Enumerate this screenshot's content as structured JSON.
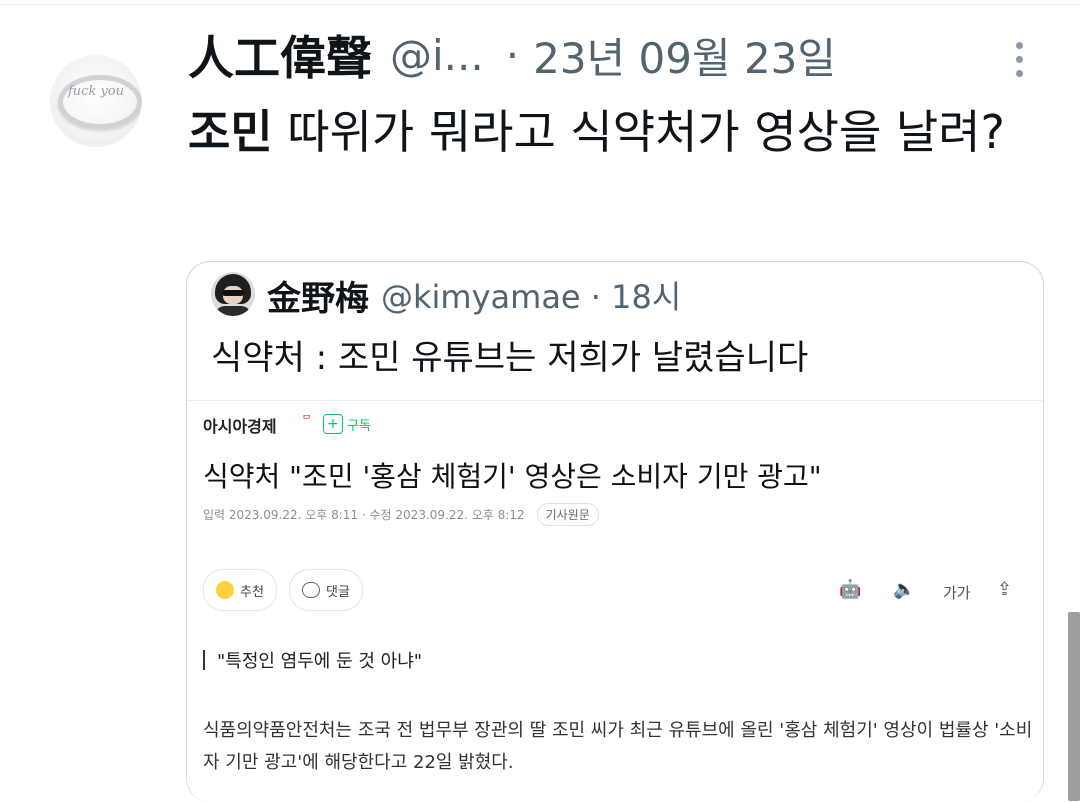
{
  "tweet": {
    "display_name": "人工偉聲",
    "handle": "@i...",
    "separator": "·",
    "date": "23년 09월 23일",
    "avatar_icon": "ring-icon",
    "avatar_text": "fuck you",
    "text_bold": "조민",
    "text_rest": " 따위가 뭐라고 식약처가 영상을 날려?"
  },
  "quoted_tweet": {
    "display_name": "金野梅",
    "handle": "@kimyamae · 18시",
    "text": "식약처 : 조민 유튜브는 저희가 날렸습니다"
  },
  "article": {
    "press": "아시아경제",
    "press_mark": "ᄆ",
    "subscribe_label": "구독",
    "headline": "식약처 \"조민 '홍삼 체험기' 영상은 소비자 기만 광고\"",
    "meta": "입력 2023.09.22. 오후 8:11 · 수정 2023.09.22. 오후 8:12",
    "original_label": "기사원문",
    "like_label": "추천",
    "comment_label": "댓글",
    "font_label": "가가",
    "subheading": "\"특정인 염두에 둔 것 아냐\"",
    "body": "식품의약품안전처는 조국 전 법무부 장관의 딸 조민 씨가 최근 유튜브에 올린 '홍삼 체험기' 영상이 법률상 '소비자 기만 광고'에 해당한다고 22일 밝혔다."
  },
  "colors": {
    "secondary_text": "#536471",
    "border": "#cfd9de",
    "subscribe_green": "#03c75a"
  }
}
